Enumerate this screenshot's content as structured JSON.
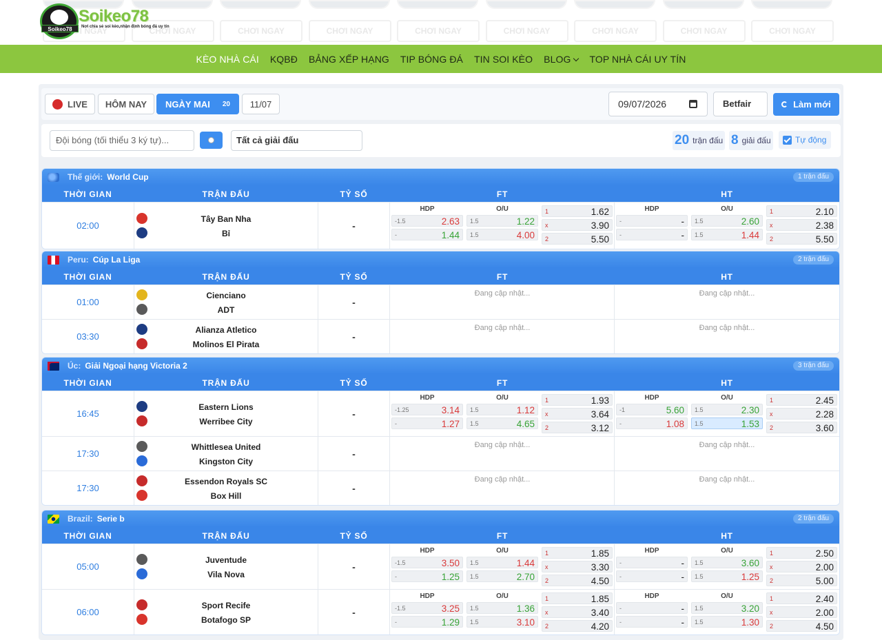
{
  "brand": {
    "name": "Soikeo78",
    "badge": "Soikeo78",
    "tagline": "Nơi chia sẻ soi kèo,nhận định bóng đá uy tín"
  },
  "ads": {
    "play_label": "CHƠI NGAY"
  },
  "nav": [
    {
      "label": "KÈO NHÀ CÁI",
      "active": true
    },
    {
      "label": "KQBĐ"
    },
    {
      "label": "BẢNG XẾP HẠNG"
    },
    {
      "label": "TIP BÓNG ĐÁ"
    },
    {
      "label": "TIN SOI KÈO"
    },
    {
      "label": "BLOG",
      "has_dropdown": true
    },
    {
      "label": "TOP NHÀ CÁI UY TÍN"
    }
  ],
  "filters": {
    "live": "LIVE",
    "today": "HÔM NAY",
    "tomorrow": "NGÀY MAI",
    "tomorrow_count": "20",
    "date_tab": "11/07",
    "date_value": "09/07/2026",
    "bookmaker": "Betfair",
    "refresh": "Làm mới",
    "search_placeholder": "Đội bóng (tối thiểu 3 ký tự)...",
    "league_select": "Tất cả giải đấu",
    "match_count": "20",
    "match_count_label": "trận đấu",
    "league_count": "8",
    "league_count_label": "giải đấu",
    "auto_label": "Tự động"
  },
  "columns": {
    "time": "THỜI GIAN",
    "match": "TRẬN ĐẤU",
    "score": "TỶ SỐ",
    "ft": "FT",
    "ht": "HT",
    "hdp": "HDP",
    "ou": "O/U"
  },
  "updating": "Đang cập nhật...",
  "colors": {
    "accent": "#3d8ef0",
    "nav_bg": "#8cc63f",
    "odds_red": "#d93a3a",
    "odds_green": "#38a337"
  },
  "leagues": [
    {
      "country": "Thế giới:",
      "name": "World Cup",
      "count": "1 trận đấu",
      "flag": "globe",
      "matches": [
        {
          "time": "02:00",
          "home": "Tây Ban Nha",
          "away": "Bỉ",
          "score": "-",
          "home_icon": "spain-flag",
          "away_icon": "belgium-flag",
          "ft": {
            "hdp": [
              [
                "-1.5",
                "2.63",
                "r"
              ],
              [
                "-",
                "1.44",
                "g"
              ]
            ],
            "ou": [
              [
                "1.5",
                "1.22",
                "g"
              ],
              [
                "1.5",
                "4.00",
                "r"
              ]
            ],
            "x12": [
              [
                "1",
                "1.62"
              ],
              [
                "x",
                "3.90"
              ],
              [
                "2",
                "5.50"
              ]
            ]
          },
          "ht": {
            "hdp": [
              [
                "-",
                "-",
                "k"
              ],
              [
                "-",
                "-",
                "k"
              ]
            ],
            "ou": [
              [
                "1.5",
                "2.60",
                "g"
              ],
              [
                "1.5",
                "1.44",
                "r"
              ]
            ],
            "x12": [
              [
                "1",
                "2.10"
              ],
              [
                "x",
                "2.38"
              ],
              [
                "2",
                "5.50"
              ]
            ]
          }
        }
      ]
    },
    {
      "country": "Peru:",
      "name": "Cúp La Liga",
      "count": "2 trận đấu",
      "flag": "peru",
      "matches": [
        {
          "time": "01:00",
          "home": "Cienciano",
          "away": "ADT",
          "score": "-"
        },
        {
          "time": "03:30",
          "home": "Alianza Atletico",
          "away": "Molinos El Pirata",
          "score": "-"
        }
      ]
    },
    {
      "country": "Úc:",
      "name": "Giải Ngoại hạng Victoria 2",
      "count": "3 trận đấu",
      "flag": "australia",
      "matches": [
        {
          "time": "16:45",
          "home": "Eastern Lions",
          "away": "Werribee City",
          "score": "-",
          "ft": {
            "hdp": [
              [
                "-1.25",
                "3.14",
                "r"
              ],
              [
                "-",
                "1.27",
                "r"
              ]
            ],
            "ou": [
              [
                "1.5",
                "1.12",
                "r"
              ],
              [
                "1.5",
                "4.65",
                "g"
              ]
            ],
            "x12": [
              [
                "1",
                "1.93"
              ],
              [
                "x",
                "3.64"
              ],
              [
                "2",
                "3.12"
              ]
            ]
          },
          "ht": {
            "hdp": [
              [
                "-1",
                "5.60",
                "g"
              ],
              [
                "-",
                "1.08",
                "r"
              ]
            ],
            "ou": [
              [
                "1.5",
                "2.30",
                "g"
              ],
              [
                "1.5",
                "1.53",
                "g"
              ]
            ],
            "x12": [
              [
                "1",
                "2.45"
              ],
              [
                "x",
                "2.28"
              ],
              [
                "2",
                "3.60"
              ]
            ]
          }
        },
        {
          "time": "17:30",
          "home": "Whittlesea United",
          "away": "Kingston City",
          "score": "-"
        },
        {
          "time": "17:30",
          "home": "Essendon Royals SC",
          "away": "Box Hill",
          "score": "-"
        }
      ]
    },
    {
      "country": "Brazil:",
      "name": "Serie b",
      "count": "2 trận đấu",
      "flag": "brazil",
      "matches": [
        {
          "time": "05:00",
          "home": "Juventude",
          "away": "Vila Nova",
          "score": "-",
          "ft": {
            "hdp": [
              [
                "-1.5",
                "3.50",
                "r"
              ],
              [
                "-",
                "1.25",
                "g"
              ]
            ],
            "ou": [
              [
                "1.5",
                "1.44",
                "r"
              ],
              [
                "1.5",
                "2.70",
                "g"
              ]
            ],
            "x12": [
              [
                "1",
                "1.85"
              ],
              [
                "x",
                "3.30"
              ],
              [
                "2",
                "4.50"
              ]
            ]
          },
          "ht": {
            "hdp": [
              [
                "-",
                "-",
                "k"
              ],
              [
                "-",
                "-",
                "k"
              ]
            ],
            "ou": [
              [
                "1.5",
                "3.60",
                "g"
              ],
              [
                "1.5",
                "1.25",
                "r"
              ]
            ],
            "x12": [
              [
                "1",
                "2.50"
              ],
              [
                "x",
                "2.00"
              ],
              [
                "2",
                "5.00"
              ]
            ]
          }
        },
        {
          "time": "06:00",
          "home": "Sport Recife",
          "away": "Botafogo SP",
          "score": "-",
          "ft": {
            "hdp": [
              [
                "-1.5",
                "3.25",
                "r"
              ],
              [
                "-",
                "1.29",
                "g"
              ]
            ],
            "ou": [
              [
                "1.5",
                "1.36",
                "g"
              ],
              [
                "1.5",
                "3.10",
                "r"
              ]
            ],
            "x12": [
              [
                "1",
                "1.85"
              ],
              [
                "x",
                "3.40"
              ],
              [
                "2",
                "4.20"
              ]
            ]
          },
          "ht": {
            "hdp": [
              [
                "-",
                "-",
                "k"
              ],
              [
                "-",
                "-",
                "k"
              ]
            ],
            "ou": [
              [
                "1.5",
                "3.20",
                "g"
              ],
              [
                "1.5",
                "1.30",
                "r"
              ]
            ],
            "x12": [
              [
                "1",
                "2.40"
              ],
              [
                "x",
                "2.00"
              ],
              [
                "2",
                "4.50"
              ]
            ]
          }
        }
      ]
    }
  ]
}
